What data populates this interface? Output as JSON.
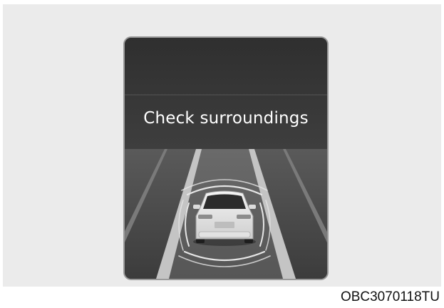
{
  "display": {
    "message": "Check surroundings",
    "car_icon": "vehicle-rear-view-icon",
    "sensor_icon": "surround-sensor-waves-icon"
  },
  "caption": "OBC3070118TU",
  "colors": {
    "panel_top": "#3a3a3a",
    "panel_road": "#4d4d4d",
    "lane_line": "#bdbdbd",
    "text": "#ffffff",
    "background": "#ebebeb"
  }
}
